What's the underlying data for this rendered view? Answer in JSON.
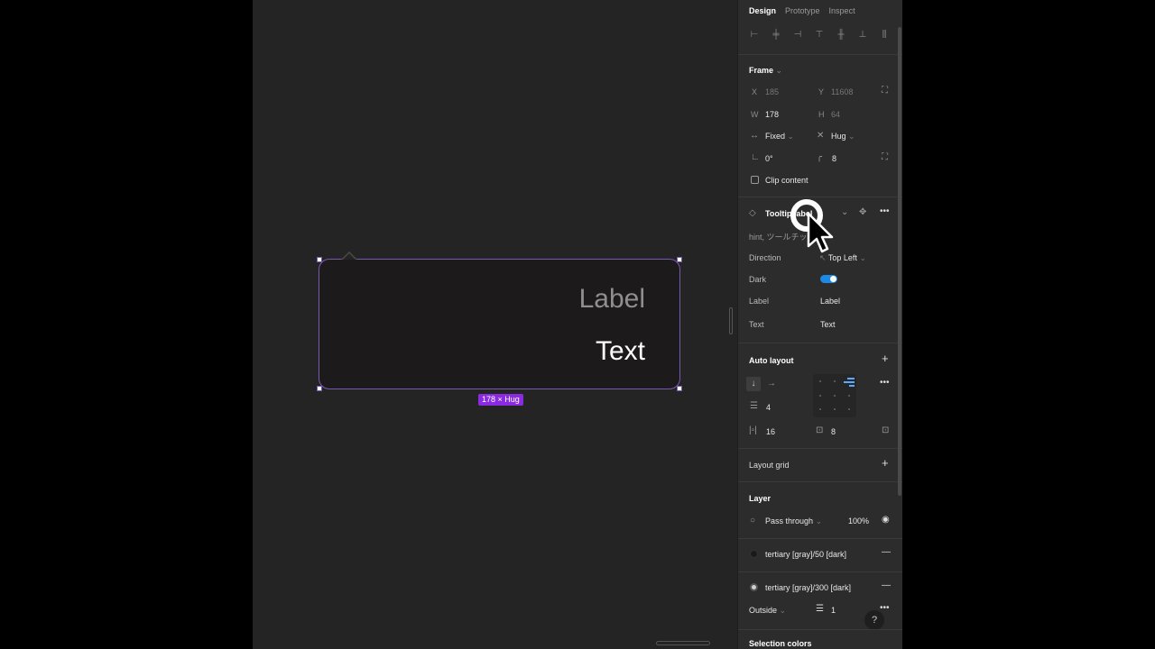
{
  "canvas": {
    "tooltip_label": "Label",
    "tooltip_text": "Text",
    "size_badge": "178 × Hug"
  },
  "tabs": [
    {
      "label": "Design",
      "active": true
    },
    {
      "label": "Prototype",
      "active": false
    },
    {
      "label": "Inspect",
      "active": false
    }
  ],
  "frame": {
    "title": "Frame",
    "x_label": "X",
    "x_value": "185",
    "y_label": "Y",
    "y_value": "11608",
    "w_label": "W",
    "w_value": "178",
    "h_label": "H",
    "h_value": "64",
    "width_mode": "Fixed",
    "height_mode": "Hug",
    "rotation": "0°",
    "radius": "8",
    "clip_content": "Clip content"
  },
  "component": {
    "name": "Tooltip label",
    "description": "hint, ツールチップ",
    "props": [
      {
        "label": "Direction",
        "value": "Top Left"
      },
      {
        "label": "Dark",
        "value": ""
      },
      {
        "label": "Label",
        "value": "Label"
      },
      {
        "label": "Text",
        "value": "Text"
      }
    ]
  },
  "auto_layout": {
    "title": "Auto layout",
    "gap": "4",
    "padding_h": "16",
    "padding_v": "8"
  },
  "layout_grid": {
    "title": "Layout grid"
  },
  "layer": {
    "title": "Layer",
    "blend": "Pass through",
    "opacity": "100%"
  },
  "fills": [
    {
      "name": "tertiary [gray]/50 [dark]",
      "color": "#1a1a1a"
    },
    {
      "name": "tertiary [gray]/300 [dark]",
      "color": "#d0d0d0"
    }
  ],
  "stroke": {
    "position": "Outside",
    "weight": "1"
  },
  "selection_colors": {
    "title": "Selection colors"
  },
  "help": "?"
}
